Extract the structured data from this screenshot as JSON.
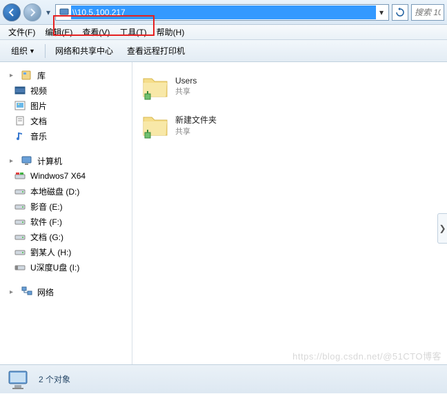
{
  "nav": {
    "address": "\\\\10.5.100.217",
    "search_placeholder": "搜索 10"
  },
  "menu": {
    "file": "文件(F)",
    "edit": "编辑(E)",
    "view": "查看(V)",
    "tools": "工具(T)",
    "help": "帮助(H)"
  },
  "toolbar": {
    "organize": "组织",
    "network_center": "网络和共享中心",
    "remote_printers": "查看远程打印机"
  },
  "sidebar": {
    "libraries": {
      "label": "库",
      "items": [
        {
          "label": "视频"
        },
        {
          "label": "图片"
        },
        {
          "label": "文档"
        },
        {
          "label": "音乐"
        }
      ]
    },
    "computer": {
      "label": "计算机",
      "items": [
        {
          "label": "Windwos7 X64"
        },
        {
          "label": "本地磁盘 (D:)"
        },
        {
          "label": "影音 (E:)"
        },
        {
          "label": "软件 (F:)"
        },
        {
          "label": "文档 (G:)"
        },
        {
          "label": "劉某人 (H:)"
        },
        {
          "label": "U深度U盘 (I:)"
        }
      ]
    },
    "network": {
      "label": "网络"
    }
  },
  "content": {
    "items": [
      {
        "name": "Users",
        "sub": "共享"
      },
      {
        "name": "新建文件夹",
        "sub": "共享"
      }
    ]
  },
  "status": {
    "text": "2 个对象"
  },
  "watermark": "https://blog.csdn.net/@51CTO博客"
}
